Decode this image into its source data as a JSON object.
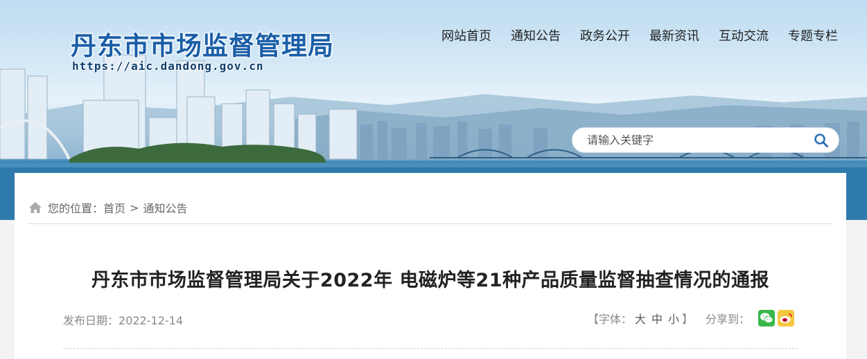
{
  "site": {
    "title": "丹东市市场监督管理局",
    "url": "https://aic.dandong.gov.cn"
  },
  "nav": {
    "items": [
      "网站首页",
      "通知公告",
      "政务公开",
      "最新资讯",
      "互动交流",
      "专题专栏"
    ]
  },
  "search": {
    "placeholder": "请输入关键字",
    "icon": "search-icon"
  },
  "breadcrumb": {
    "icon": "home-icon",
    "prefix": "您的位置：",
    "home": "首页",
    "separator": ">",
    "current": "通知公告"
  },
  "article": {
    "title": "丹东市市场监督管理局关于2022年 电磁炉等21种产品质量监督抽查情况的通报",
    "date_label": "发布日期：",
    "date": "2022-12-14"
  },
  "font_size": {
    "open": "【字体：",
    "large": "大",
    "medium": "中",
    "small": "小",
    "close": "】"
  },
  "share": {
    "label": "分享到：",
    "icons": [
      "wechat-icon",
      "weibo-icon"
    ]
  },
  "colors": {
    "title_blue": "#1a5ea8",
    "wechat_green": "#3bb64a",
    "weibo_yellow": "#f5c842"
  }
}
